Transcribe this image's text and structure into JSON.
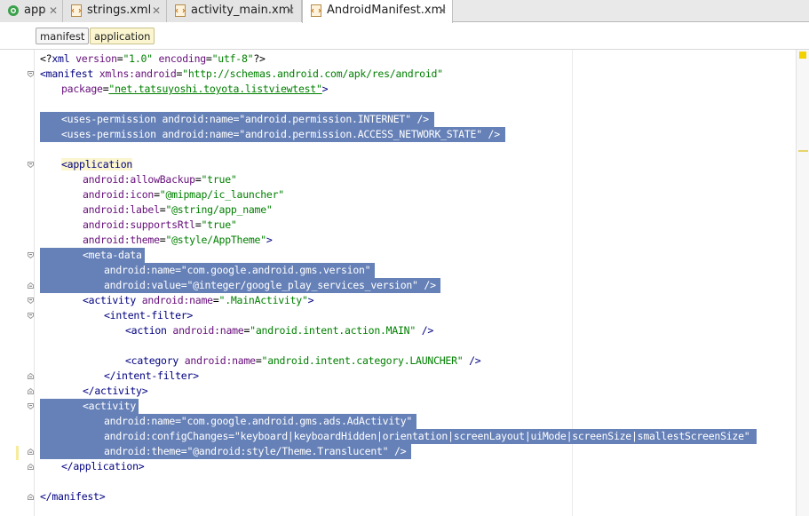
{
  "tabs": [
    {
      "label": "app",
      "icon": "android-module-icon",
      "active": false
    },
    {
      "label": "strings.xml",
      "icon": "xml-file-icon",
      "active": false
    },
    {
      "label": "activity_main.xml",
      "icon": "layout-file-icon",
      "active": false
    },
    {
      "label": "AndroidManifest.xml",
      "icon": "manifest-file-icon",
      "active": true
    }
  ],
  "breadcrumb": [
    "manifest",
    "application"
  ],
  "colors": {
    "selection": "#6681b8",
    "tag": "#000080",
    "attribute": "#660e7a",
    "value": "#008000"
  },
  "code_lines": [
    {
      "n": 1,
      "indent": 0,
      "sel": false,
      "tokens": [
        [
          "bl",
          "<?"
        ],
        [
          "tg",
          "xml "
        ],
        [
          "at",
          "version"
        ],
        [
          "bl",
          "="
        ],
        [
          "av",
          "\"1.0\""
        ],
        [
          "bl",
          " "
        ],
        [
          "at",
          "encoding"
        ],
        [
          "bl",
          "="
        ],
        [
          "av",
          "\"utf-8\""
        ],
        [
          "bl",
          "?>"
        ]
      ]
    },
    {
      "n": 2,
      "indent": 0,
      "sel": false,
      "tokens": [
        [
          "tg",
          "<manifest "
        ],
        [
          "at",
          "xmlns:android"
        ],
        [
          "bl",
          "="
        ],
        [
          "av",
          "\"http://schemas.android.com/apk/res/android\""
        ]
      ]
    },
    {
      "n": 3,
      "indent": 1,
      "sel": false,
      "tokens": [
        [
          "at",
          "package"
        ],
        [
          "bl",
          "="
        ],
        [
          "av",
          "\"net.tatsuyoshi.toyota.listviewtest\""
        ],
        [
          "tg",
          ">"
        ]
      ]
    },
    {
      "n": 4,
      "indent": 0,
      "sel": false,
      "tokens": []
    },
    {
      "n": 5,
      "indent": 1,
      "sel": true,
      "tokens": [
        [
          "tg",
          "<uses-permission "
        ],
        [
          "at",
          "android:name"
        ],
        [
          "bl",
          "="
        ],
        [
          "av",
          "\"android.permission.INTERNET\""
        ],
        [
          "tg",
          " />"
        ]
      ]
    },
    {
      "n": 6,
      "indent": 1,
      "sel": true,
      "tokens": [
        [
          "tg",
          "<uses-permission "
        ],
        [
          "at",
          "android:name"
        ],
        [
          "bl",
          "="
        ],
        [
          "av",
          "\"android.permission.ACCESS_NETWORK_STATE\""
        ],
        [
          "tg",
          " />"
        ]
      ]
    },
    {
      "n": 7,
      "indent": 0,
      "sel": false,
      "tokens": []
    },
    {
      "n": 8,
      "indent": 1,
      "sel": false,
      "tokens": [
        [
          "tg",
          "<application"
        ]
      ]
    },
    {
      "n": 9,
      "indent": 2,
      "sel": false,
      "tokens": [
        [
          "at",
          "android:allowBackup"
        ],
        [
          "bl",
          "="
        ],
        [
          "av",
          "\"true\""
        ]
      ]
    },
    {
      "n": 10,
      "indent": 2,
      "sel": false,
      "tokens": [
        [
          "at",
          "android:icon"
        ],
        [
          "bl",
          "="
        ],
        [
          "av",
          "\"@mipmap/ic_launcher\""
        ]
      ]
    },
    {
      "n": 11,
      "indent": 2,
      "sel": false,
      "tokens": [
        [
          "at",
          "android:label"
        ],
        [
          "bl",
          "="
        ],
        [
          "av",
          "\"@string/app_name\""
        ]
      ]
    },
    {
      "n": 12,
      "indent": 2,
      "sel": false,
      "tokens": [
        [
          "at",
          "android:supportsRtl"
        ],
        [
          "bl",
          "="
        ],
        [
          "av",
          "\"true\""
        ]
      ]
    },
    {
      "n": 13,
      "indent": 2,
      "sel": false,
      "tokens": [
        [
          "at",
          "android:theme"
        ],
        [
          "bl",
          "="
        ],
        [
          "av",
          "\"@style/AppTheme\""
        ],
        [
          "tg",
          ">"
        ]
      ]
    },
    {
      "n": 14,
      "indent": 2,
      "sel": true,
      "tokens": [
        [
          "tg",
          "<meta-data"
        ]
      ]
    },
    {
      "n": 15,
      "indent": 3,
      "sel": true,
      "tokens": [
        [
          "at",
          "android:name"
        ],
        [
          "bl",
          "="
        ],
        [
          "av",
          "\"com.google.android.gms.version\""
        ]
      ]
    },
    {
      "n": 16,
      "indent": 3,
      "sel": true,
      "tokens": [
        [
          "at",
          "android:value"
        ],
        [
          "bl",
          "="
        ],
        [
          "av",
          "\"@integer/google_play_services_version\""
        ],
        [
          "tg",
          " />"
        ]
      ]
    },
    {
      "n": 17,
      "indent": 2,
      "sel": false,
      "tokens": [
        [
          "tg",
          "<activity "
        ],
        [
          "at",
          "android:name"
        ],
        [
          "bl",
          "="
        ],
        [
          "av",
          "\".MainActivity\""
        ],
        [
          "tg",
          ">"
        ]
      ]
    },
    {
      "n": 18,
      "indent": 3,
      "sel": false,
      "tokens": [
        [
          "tg",
          "<intent-filter>"
        ]
      ]
    },
    {
      "n": 19,
      "indent": 4,
      "sel": false,
      "tokens": [
        [
          "tg",
          "<action "
        ],
        [
          "at",
          "android:name"
        ],
        [
          "bl",
          "="
        ],
        [
          "av",
          "\"android.intent.action.MAIN\""
        ],
        [
          "tg",
          " />"
        ]
      ]
    },
    {
      "n": 20,
      "indent": 0,
      "sel": false,
      "tokens": []
    },
    {
      "n": 21,
      "indent": 4,
      "sel": false,
      "tokens": [
        [
          "tg",
          "<category "
        ],
        [
          "at",
          "android:name"
        ],
        [
          "bl",
          "="
        ],
        [
          "av",
          "\"android.intent.category.LAUNCHER\""
        ],
        [
          "tg",
          " />"
        ]
      ]
    },
    {
      "n": 22,
      "indent": 3,
      "sel": false,
      "tokens": [
        [
          "tg",
          "</intent-filter>"
        ]
      ]
    },
    {
      "n": 23,
      "indent": 2,
      "sel": false,
      "tokens": [
        [
          "tg",
          "</activity>"
        ]
      ]
    },
    {
      "n": 24,
      "indent": 2,
      "sel": true,
      "tokens": [
        [
          "tg",
          "<activity"
        ]
      ]
    },
    {
      "n": 25,
      "indent": 3,
      "sel": true,
      "tokens": [
        [
          "at",
          "android:name"
        ],
        [
          "bl",
          "="
        ],
        [
          "av",
          "\"com.google.android.gms.ads.AdActivity\""
        ]
      ]
    },
    {
      "n": 26,
      "indent": 3,
      "sel": true,
      "tokens": [
        [
          "at",
          "android:configChanges"
        ],
        [
          "bl",
          "="
        ],
        [
          "av",
          "\"keyboard|keyboardHidden|orientation|screenLayout|uiMode|screenSize|smallestScreenSize\""
        ]
      ]
    },
    {
      "n": 27,
      "indent": 3,
      "sel": true,
      "tokens": [
        [
          "at",
          "android:theme"
        ],
        [
          "bl",
          "="
        ],
        [
          "av",
          "\"@android:style/Theme.Translucent\""
        ],
        [
          "tg",
          " />"
        ]
      ]
    },
    {
      "n": 28,
      "indent": 1,
      "sel": false,
      "tokens": [
        [
          "tg",
          "</application>"
        ]
      ]
    },
    {
      "n": 29,
      "indent": 0,
      "sel": false,
      "tokens": []
    },
    {
      "n": 30,
      "indent": 0,
      "sel": false,
      "tokens": [
        [
          "tg",
          "</manifest>"
        ]
      ]
    }
  ]
}
